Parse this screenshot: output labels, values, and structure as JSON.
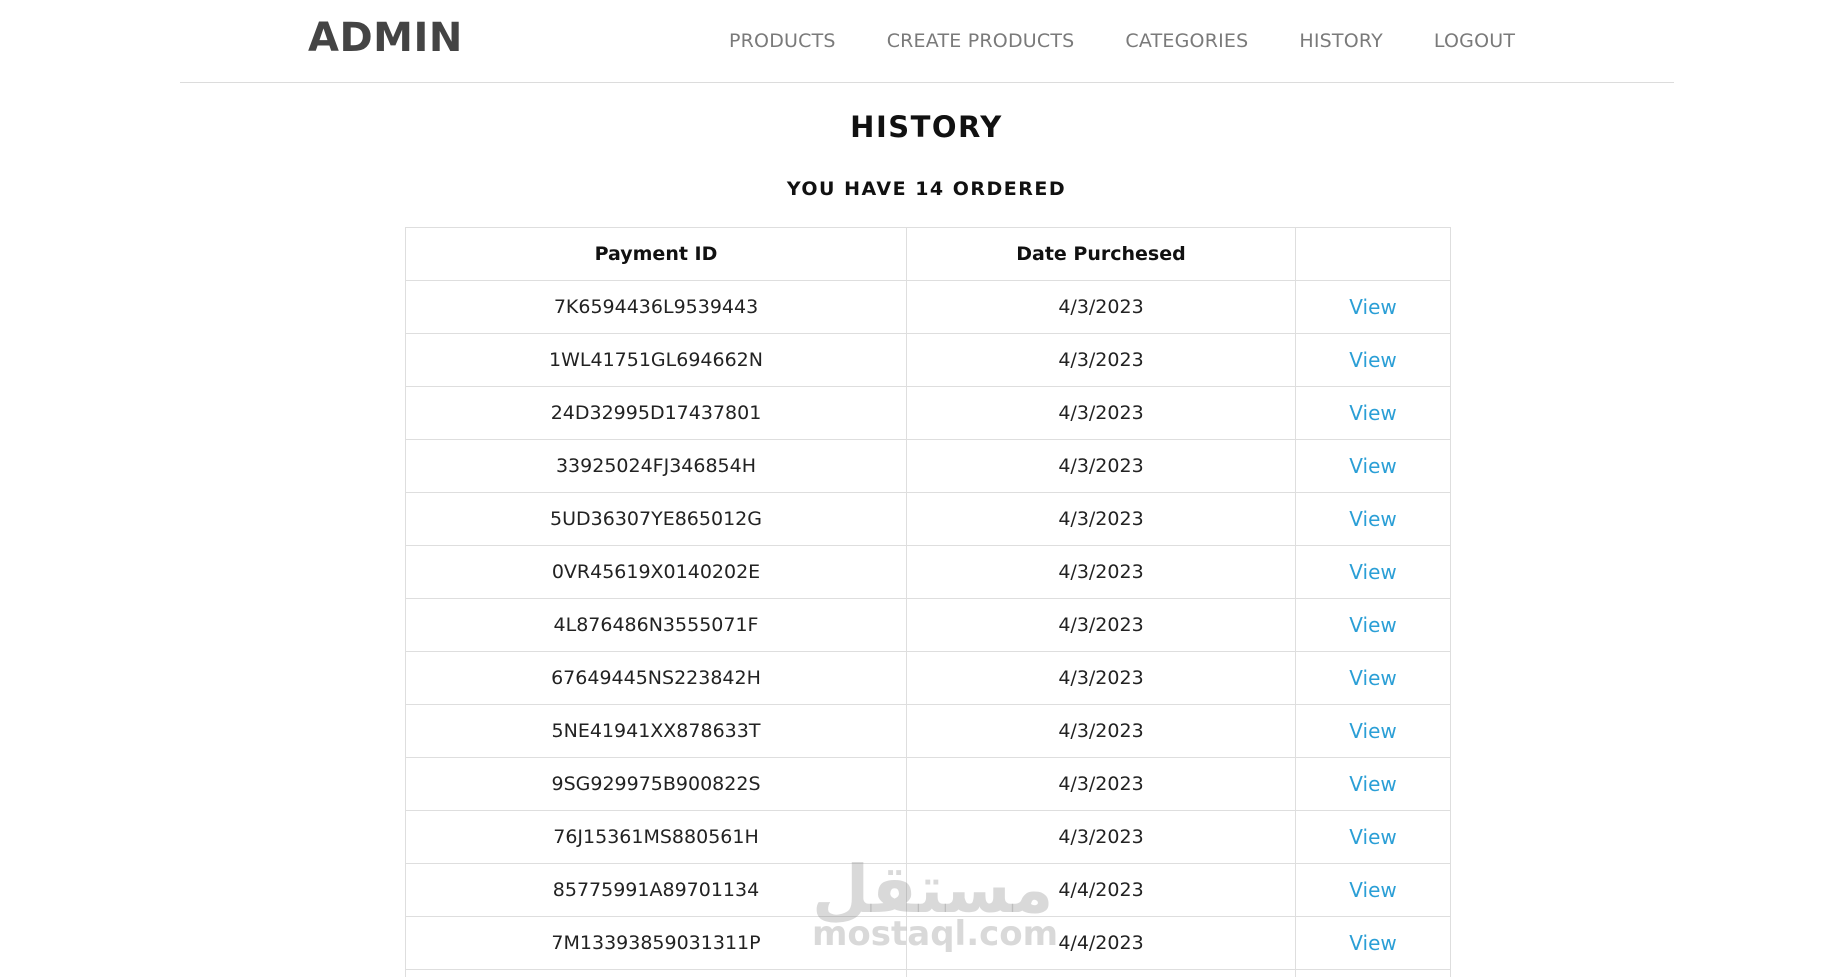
{
  "brand": "ADMIN",
  "nav": {
    "items": [
      {
        "label": "PRODUCTS"
      },
      {
        "label": "CREATE PRODUCTS"
      },
      {
        "label": "CATEGORIES"
      },
      {
        "label": "HISTORY"
      },
      {
        "label": "LOGOUT"
      }
    ]
  },
  "title": "HISTORY",
  "subtitle": "YOU HAVE 14 ORDERED",
  "table": {
    "headers": [
      "Payment ID",
      "Date Purchesed",
      ""
    ],
    "rows": [
      {
        "payment_id": "7K6594436L9539443",
        "date": "4/3/2023",
        "action": "View"
      },
      {
        "payment_id": "1WL41751GL694662N",
        "date": "4/3/2023",
        "action": "View"
      },
      {
        "payment_id": "24D32995D17437801",
        "date": "4/3/2023",
        "action": "View"
      },
      {
        "payment_id": "33925024FJ346854H",
        "date": "4/3/2023",
        "action": "View"
      },
      {
        "payment_id": "5UD36307YE865012G",
        "date": "4/3/2023",
        "action": "View"
      },
      {
        "payment_id": "0VR45619X0140202E",
        "date": "4/3/2023",
        "action": "View"
      },
      {
        "payment_id": "4L876486N3555071F",
        "date": "4/3/2023",
        "action": "View"
      },
      {
        "payment_id": "67649445NS223842H",
        "date": "4/3/2023",
        "action": "View"
      },
      {
        "payment_id": "5NE41941XX878633T",
        "date": "4/3/2023",
        "action": "View"
      },
      {
        "payment_id": "9SG929975B900822S",
        "date": "4/3/2023",
        "action": "View"
      },
      {
        "payment_id": "76J15361MS880561H",
        "date": "4/3/2023",
        "action": "View"
      },
      {
        "payment_id": "85775991A89701134",
        "date": "4/4/2023",
        "action": "View"
      },
      {
        "payment_id": "7M13393859031311P",
        "date": "4/4/2023",
        "action": "View"
      }
    ]
  },
  "watermark": {
    "arabic": "مستقل",
    "latin": "mostaql.com"
  }
}
